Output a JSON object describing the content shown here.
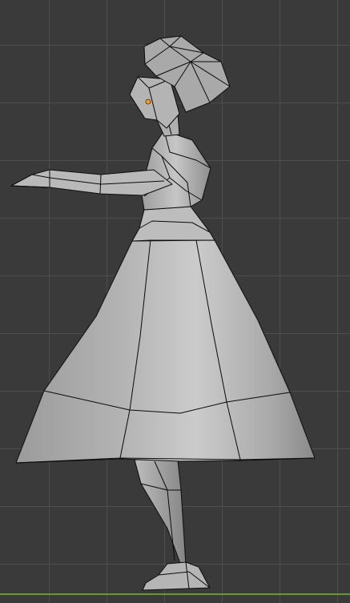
{
  "viewport": {
    "mode": "object-mode",
    "view": "right-orthographic",
    "colors": {
      "background": "#3a3a3a",
      "grid_line": "#505050",
      "mesh_light": "#c9c9c9",
      "mesh_mid": "#a6a6a6",
      "mesh_dark": "#7a7a7a",
      "wire": "#0a0a0a",
      "origin_point": "#f29d25",
      "floor_axis": "#7bb236"
    }
  },
  "scene": {
    "object": "low-poly-woman-figure",
    "origin_marker": "orange-dot"
  }
}
